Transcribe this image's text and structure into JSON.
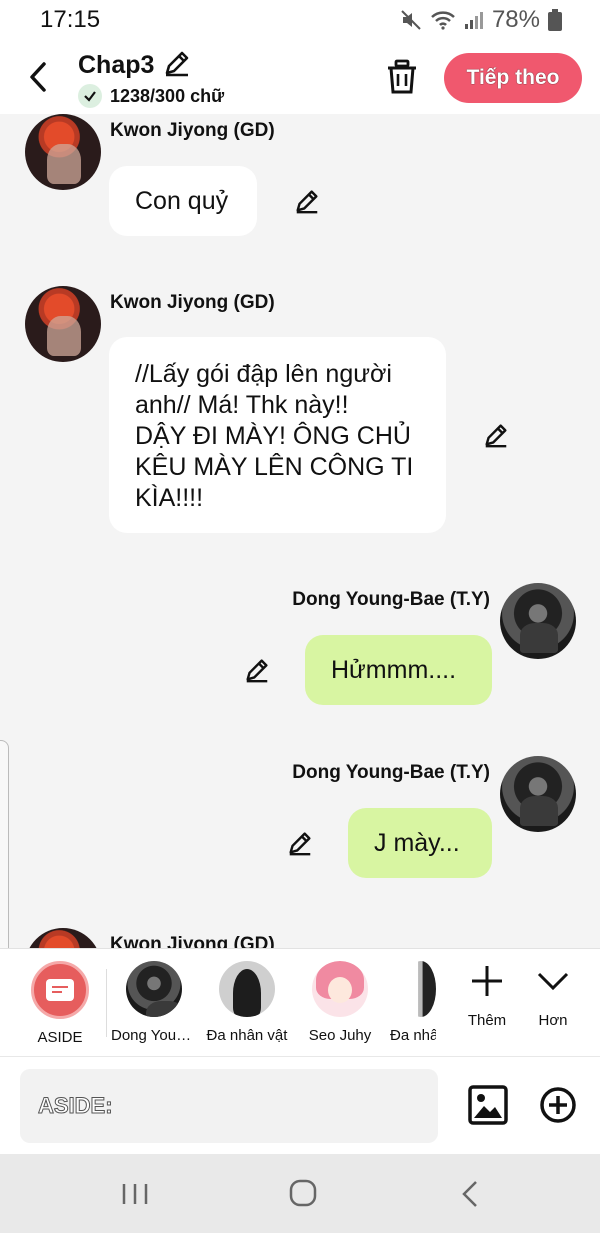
{
  "status_bar": {
    "time": "17:15",
    "battery": "78%"
  },
  "header": {
    "title": "Chap3",
    "word_count": "1238/300 chữ",
    "next_label": "Tiếp theo",
    "accent_color": "#f0586e"
  },
  "messages": [
    {
      "side": "left",
      "speaker": "Kwon Jiyong (GD)",
      "text": "Con quỷ"
    },
    {
      "side": "left",
      "speaker": "Kwon Jiyong (GD)",
      "lines": [
        "//Lấy gói đập lên người",
        "anh// Má! Thk này!!",
        "DẬY ĐI MÀY! ÔNG  CHỦ",
        "KÊU MÀY LÊN CÔNG TI",
        "KÌA!!!!"
      ]
    },
    {
      "side": "right",
      "speaker": "Dong Young-Bae (T.Y)",
      "text": "Hửmmm...."
    },
    {
      "side": "right",
      "speaker": "Dong Young-Bae (T.Y)",
      "text": "J mày..."
    },
    {
      "side": "left",
      "speaker": "Kwon Jiyong (GD)"
    }
  ],
  "characters": [
    {
      "label": "ASIDE"
    },
    {
      "label": "Dong Young-Bae (T.Y)"
    },
    {
      "label": "Đa nhân vật"
    },
    {
      "label": "Seo Juhy"
    },
    {
      "label": "Đa nhân vật"
    }
  ],
  "tools": {
    "add_label": "Thêm",
    "more_label": "Hơn"
  },
  "composer": {
    "label": "ASIDE:"
  }
}
